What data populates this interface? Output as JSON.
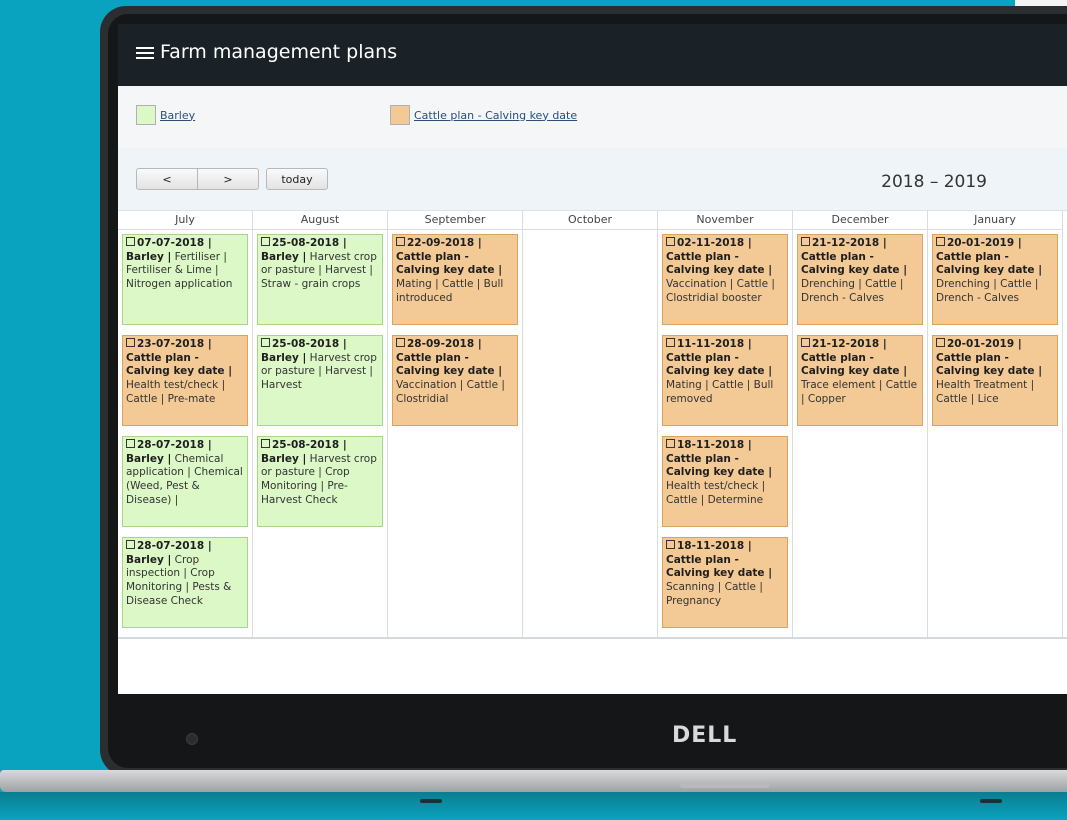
{
  "app": {
    "title": "Farm management plans"
  },
  "legend": [
    {
      "label": "Barley",
      "color": "#dcf8c6"
    },
    {
      "label": "Cattle plan - Calving key date",
      "color": "#f3c996"
    }
  ],
  "toolbar": {
    "prev": "<",
    "next": ">",
    "today": "today",
    "range": "2018 – 2019"
  },
  "months": [
    {
      "name": "July",
      "events": [
        {
          "date": "07-07-2018 |",
          "plan": "Barley |",
          "desc": "Fertiliser | Fertiliser & Lime | Nitrogen application",
          "type": "barley"
        },
        {
          "date": "23-07-2018 |",
          "plan": "Cattle plan - Calving key date |",
          "desc": "Health test/check | Cattle | Pre-mate",
          "type": "cattle"
        },
        {
          "date": "28-07-2018 |",
          "plan": "Barley |",
          "desc": "Chemical application | Chemical (Weed, Pest & Disease) |",
          "type": "barley"
        },
        {
          "date": "28-07-2018 |",
          "plan": "Barley |",
          "desc": "Crop inspection | Crop Monitoring | Pests & Disease Check",
          "type": "barley"
        }
      ]
    },
    {
      "name": "August",
      "events": [
        {
          "date": "25-08-2018 |",
          "plan": "Barley |",
          "desc": "Harvest crop or pasture | Harvest | Straw - grain crops",
          "type": "barley"
        },
        {
          "date": "25-08-2018 |",
          "plan": "Barley |",
          "desc": "Harvest crop or pasture | Harvest | Harvest",
          "type": "barley"
        },
        {
          "date": "25-08-2018 |",
          "plan": "Barley |",
          "desc": "Harvest crop or pasture | Crop Monitoring | Pre-Harvest Check",
          "type": "barley"
        }
      ]
    },
    {
      "name": "September",
      "events": [
        {
          "date": "22-09-2018 |",
          "plan": "Cattle plan - Calving key date |",
          "desc": "Mating | Cattle | Bull introduced",
          "type": "cattle"
        },
        {
          "date": "28-09-2018 |",
          "plan": "Cattle plan - Calving key date |",
          "desc": "Vaccination | Cattle | Clostridial",
          "type": "cattle"
        }
      ]
    },
    {
      "name": "October",
      "events": []
    },
    {
      "name": "November",
      "events": [
        {
          "date": "02-11-2018 |",
          "plan": "Cattle plan - Calving key date |",
          "desc": "Vaccination | Cattle | Clostridial booster",
          "type": "cattle"
        },
        {
          "date": "11-11-2018 |",
          "plan": "Cattle plan - Calving key date |",
          "desc": "Mating | Cattle | Bull removed",
          "type": "cattle"
        },
        {
          "date": "18-11-2018 |",
          "plan": "Cattle plan - Calving key date |",
          "desc": "Health test/check | Cattle | Determine",
          "type": "cattle"
        },
        {
          "date": "18-11-2018 |",
          "plan": "Cattle plan - Calving key date |",
          "desc": "Scanning | Cattle | Pregnancy",
          "type": "cattle"
        }
      ]
    },
    {
      "name": "December",
      "events": [
        {
          "date": "21-12-2018 |",
          "plan": "Cattle plan - Calving key date |",
          "desc": "Drenching | Cattle | Drench - Calves",
          "type": "cattle"
        },
        {
          "date": "21-12-2018 |",
          "plan": "Cattle plan - Calving key date |",
          "desc": "Trace element | Cattle | Copper",
          "type": "cattle"
        }
      ]
    },
    {
      "name": "January",
      "events": [
        {
          "date": "20-01-2019 |",
          "plan": "Cattle plan - Calving key date |",
          "desc": "Drenching | Cattle | Drench - Calves",
          "type": "cattle"
        },
        {
          "date": "20-01-2019 |",
          "plan": "Cattle plan - Calving key date |",
          "desc": "Health Treatment | Cattle | Lice",
          "type": "cattle"
        }
      ]
    }
  ],
  "device": {
    "brand": "DELL"
  }
}
